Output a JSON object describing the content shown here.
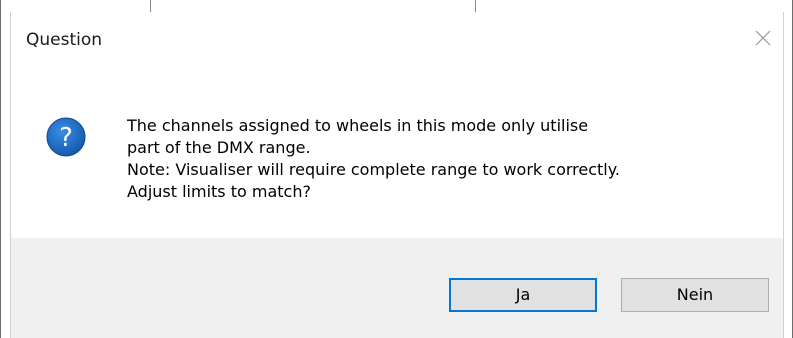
{
  "dialog": {
    "title": "Question",
    "close_icon": "close-icon",
    "icon": "question-icon",
    "message_lines": [
      "The channels assigned to wheels in this mode only utilise",
      "part of the DMX range.",
      "Note: Visualiser will require complete range to work correctly.",
      "Adjust limits to match?"
    ],
    "buttons": {
      "yes_label": "Ja",
      "no_label": "Nein"
    }
  },
  "colors": {
    "accent": "#0078d7",
    "footer_bg": "#f0f0f0",
    "button_bg": "#e1e1e1",
    "icon_bg": "#1c64b4"
  }
}
